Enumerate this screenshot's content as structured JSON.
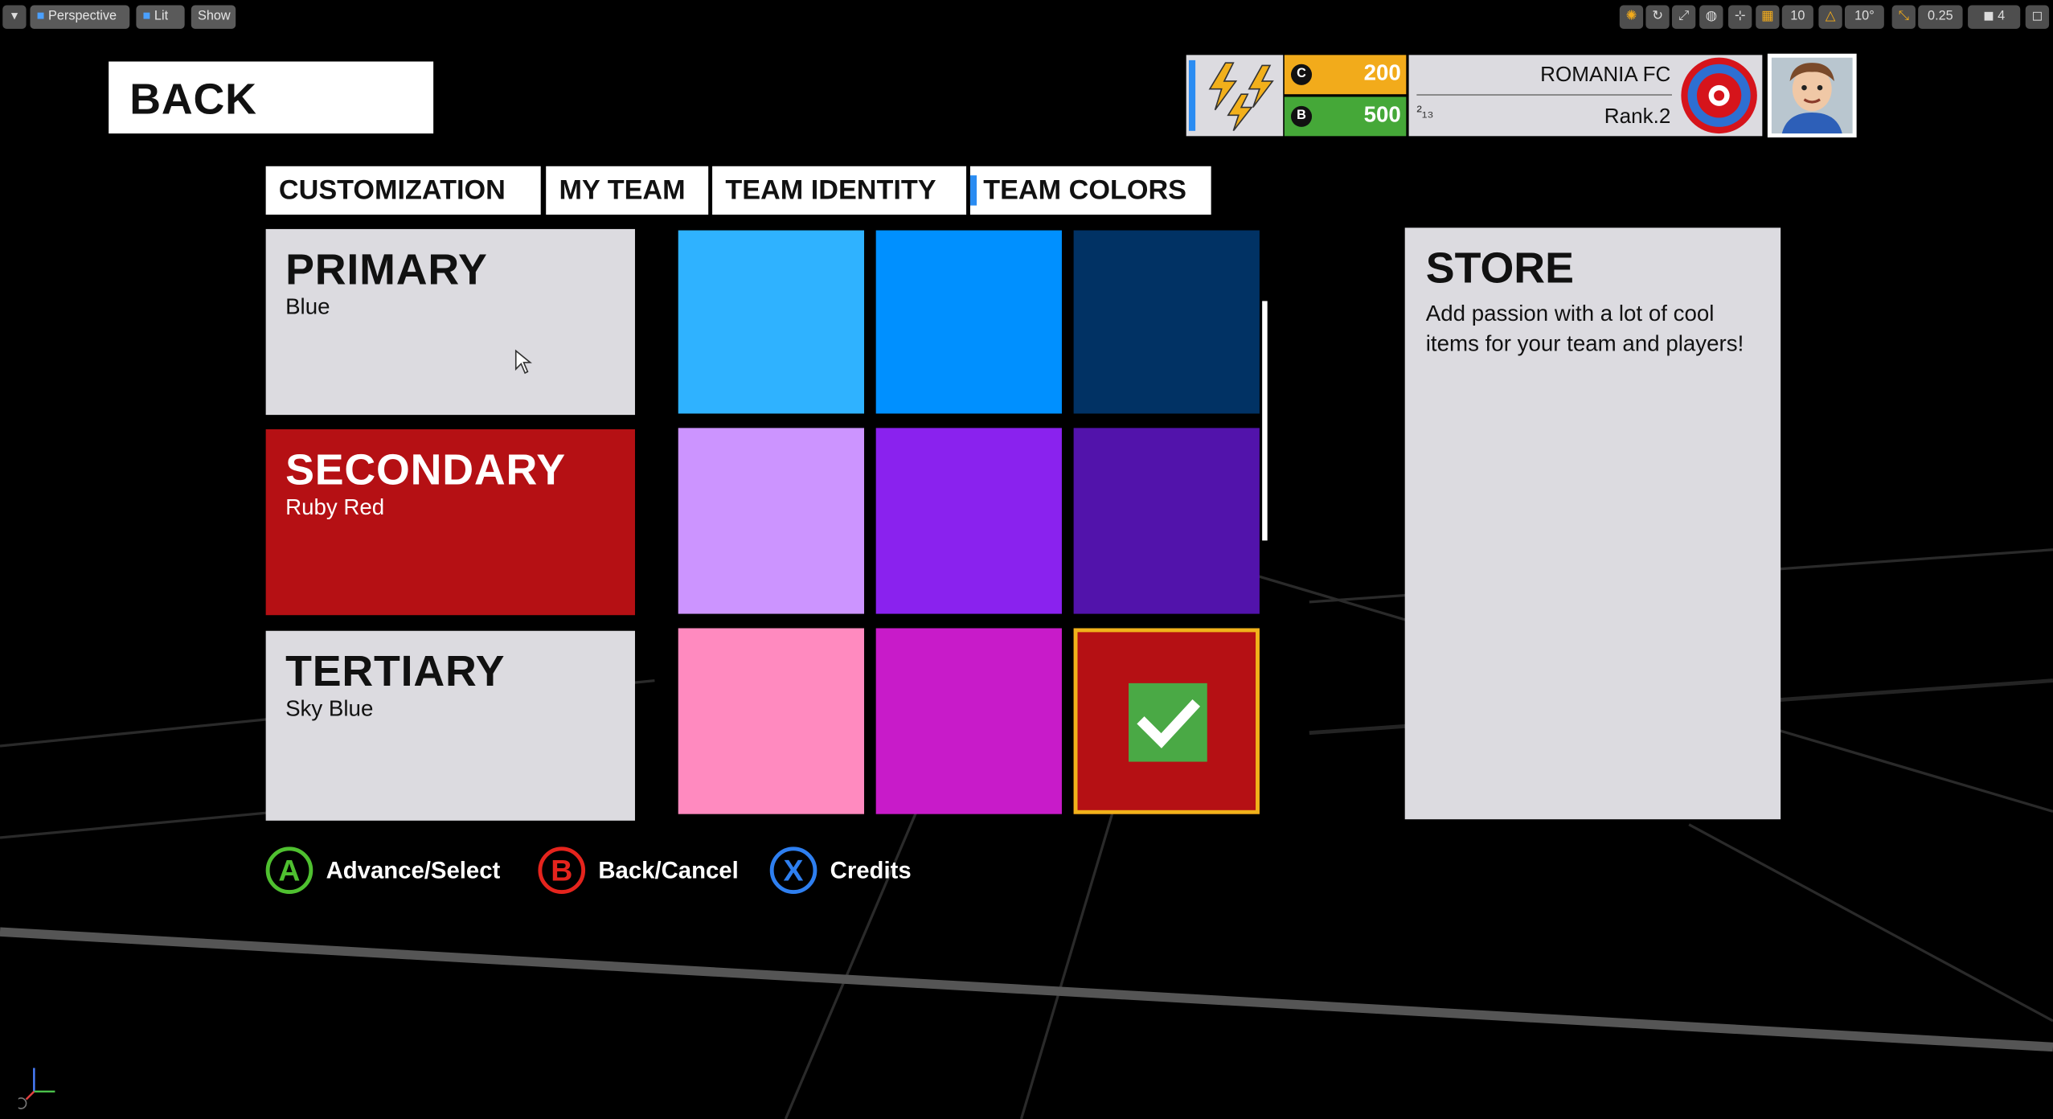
{
  "editor_toolbar": {
    "perspective_label": "Perspective",
    "lit_label": "Lit",
    "show_label": "Show",
    "grid_snap_value": "10",
    "rotation_snap_value": "10°",
    "scale_snap_value": "0.25",
    "camera_speed_value": "4"
  },
  "back_button": {
    "label": "BACK"
  },
  "tabs": [
    {
      "label": "CUSTOMIZATION"
    },
    {
      "label": "MY TEAM"
    },
    {
      "label": "TEAM IDENTITY"
    },
    {
      "label": "TEAM COLORS",
      "active": true
    }
  ],
  "hud": {
    "coins_badge": "C",
    "coins": "200",
    "bucks_badge": "B",
    "bucks": "500",
    "team_name": "ROMANIA FC",
    "rank": "Rank.2",
    "rank_glyph": "²₁₃"
  },
  "slots": [
    {
      "title": "PRIMARY",
      "value": "Blue",
      "bg": "#dcdbe0",
      "fg": "#111111"
    },
    {
      "title": "SECONDARY",
      "value": "Ruby Red",
      "bg": "#b51014",
      "fg": "#ffffff"
    },
    {
      "title": "TERTIARY",
      "value": "Sky Blue",
      "bg": "#dcdbe0",
      "fg": "#111111"
    }
  ],
  "swatches": [
    [
      "#2fb2ff",
      "#0090ff",
      "#013264"
    ],
    [
      "#cc94ff",
      "#8a22ee",
      "#5213ab"
    ],
    [
      "#ff8abf",
      "#c81bc9",
      "#b51014"
    ]
  ],
  "selected_swatch": {
    "row": 3,
    "col": 3,
    "highlight": "#f0b21b",
    "check_bg": "#4aa945"
  },
  "store": {
    "title": "STORE",
    "description": "Add passion with a lot of cool items for your team and players!"
  },
  "prompts": [
    {
      "key": "A",
      "label": "Advance/Select",
      "color": "#4fc030"
    },
    {
      "key": "B",
      "label": "Back/Cancel",
      "color": "#e5241d"
    },
    {
      "key": "X",
      "label": "Credits",
      "color": "#2e7ff0"
    }
  ],
  "colors": {
    "coin_bar": "#f2ab1b",
    "bucks_bar": "#45a838",
    "energy_accent": "#2a8cf2",
    "lightning": "#f2b01b",
    "crest_ring": "#d6141b",
    "crest_inner": "#2e6fd2"
  }
}
